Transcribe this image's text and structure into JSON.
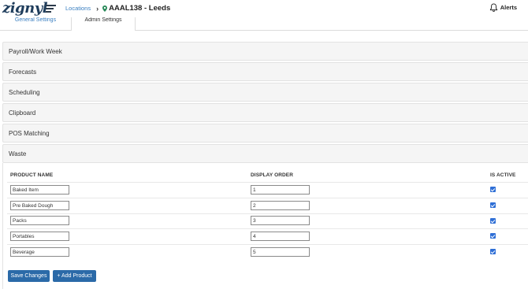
{
  "header": {
    "logo": "zignyl",
    "breadcrumb_link": "Locations",
    "breadcrumb_separator": "›",
    "location_title": "AAAL138 - Leeds",
    "alerts_label": "Alerts"
  },
  "tabs": [
    {
      "label": "General Settings",
      "active": false
    },
    {
      "label": "Admin Settings",
      "active": true
    }
  ],
  "sections": [
    "Payroll/Work Week",
    "Forecasts",
    "Scheduling",
    "Clipboard",
    "POS Matching",
    "Waste"
  ],
  "waste_table": {
    "columns": [
      "PRODUCT NAME",
      "DISPLAY ORDER",
      "IS ACTIVE"
    ],
    "rows": [
      {
        "product_name": "Baked Item",
        "display_order": "1",
        "is_active": true
      },
      {
        "product_name": "Pre Baked Dough",
        "display_order": "2",
        "is_active": true
      },
      {
        "product_name": "Packs",
        "display_order": "3",
        "is_active": true
      },
      {
        "product_name": "Portables",
        "display_order": "4",
        "is_active": true
      },
      {
        "product_name": "Beverage",
        "display_order": "5",
        "is_active": true
      }
    ]
  },
  "buttons": {
    "save_label": "Save Changes",
    "add_label": "+ Add Product"
  },
  "colors": {
    "link": "#3a7fc1",
    "button": "#2b6aa8",
    "checkbox": "#2f6fd6",
    "panel_bg": "#f5f5f5"
  }
}
